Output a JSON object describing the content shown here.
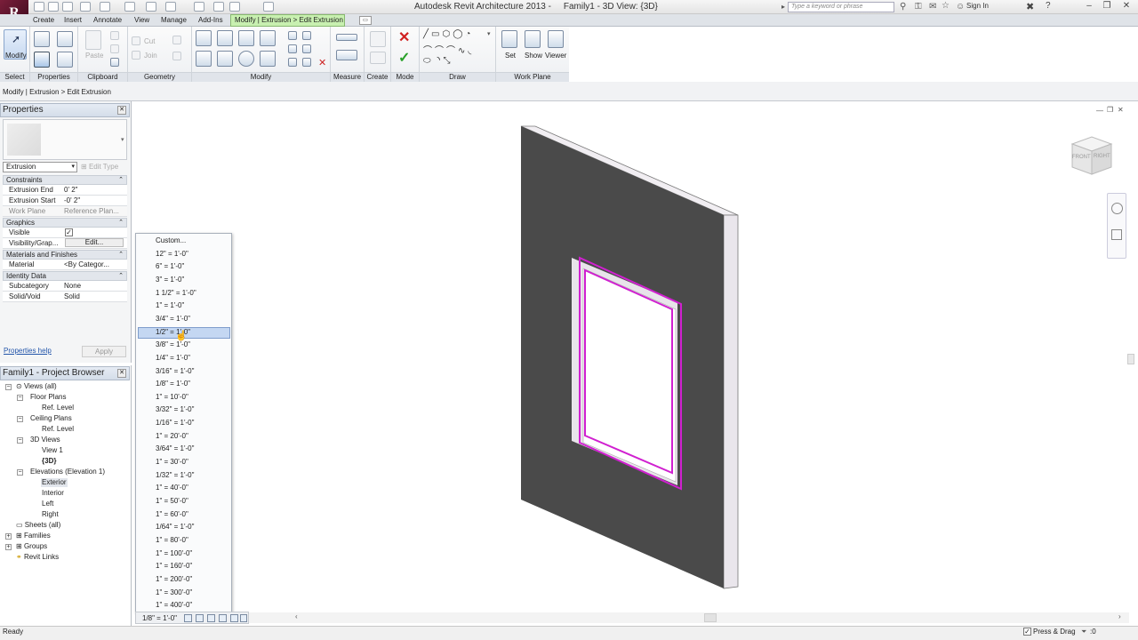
{
  "app": {
    "title": "Autodesk Revit Architecture 2013 -     Family1 - 3D View: {3D}",
    "logo": "R",
    "search_placeholder": "Type a keyword or phrase",
    "signin": "Sign In",
    "accent": "#c8f0b0"
  },
  "menu": {
    "tabs": [
      "Create",
      "Insert",
      "Annotate",
      "View",
      "Manage",
      "Add-Ins"
    ],
    "context_tab": "Modify | Extrusion > Edit Extrusion"
  },
  "ribbon": {
    "modify_label": "Modify",
    "panels": [
      "Select",
      "Properties",
      "Clipboard",
      "Geometry",
      "Modify",
      "Measure",
      "Create",
      "Mode",
      "Draw",
      "Work Plane"
    ],
    "clipboard": {
      "paste": "Paste",
      "cut": "Cut",
      "join": "Join"
    },
    "workplane": {
      "set": "Set",
      "show": "Show",
      "viewer": "Viewer"
    }
  },
  "mode_bar": "Modify | Extrusion > Edit Extrusion",
  "properties": {
    "title": "Properties",
    "type": "Extrusion",
    "edit_type": "Edit Type",
    "groups": {
      "constraints": "Constraints",
      "graphics": "Graphics",
      "materials": "Materials and Finishes",
      "identity": "Identity Data"
    },
    "rows": {
      "extrusion_end": {
        "k": "Extrusion End",
        "v": "0'  2\""
      },
      "extrusion_start": {
        "k": "Extrusion Start",
        "v": "-0'  2\""
      },
      "work_plane": {
        "k": "Work Plane",
        "v": "Reference Plan..."
      },
      "visible": {
        "k": "Visible",
        "v": "✓"
      },
      "visibility": {
        "k": "Visibility/Grap...",
        "v": "Edit..."
      },
      "material": {
        "k": "Material",
        "v": "<By Categor..."
      },
      "subcategory": {
        "k": "Subcategory",
        "v": "None"
      },
      "solid_void": {
        "k": "Solid/Void",
        "v": "Solid"
      }
    },
    "help": "Properties help",
    "apply": "Apply"
  },
  "browser": {
    "title": "Family1 - Project Browser",
    "views_all": "Views (all)",
    "floor_plans": "Floor Plans",
    "ref_level_1": "Ref. Level",
    "ceiling_plans": "Ceiling Plans",
    "ref_level_2": "Ref. Level",
    "views_3d": "3D Views",
    "view1": "View 1",
    "view_3d": "{3D}",
    "elevations": "Elevations (Elevation 1)",
    "exterior": "Exterior",
    "interior": "Interior",
    "left": "Left",
    "right": "Right",
    "sheets": "Sheets (all)",
    "families": "Families",
    "groups": "Groups",
    "revit_links": "Revit Links"
  },
  "scale_menu": {
    "items": [
      "Custom...",
      "12\" = 1'-0\"",
      "6\" = 1'-0\"",
      "3\" = 1'-0\"",
      "1 1/2\" = 1'-0\"",
      "1\" = 1'-0\"",
      "3/4\" = 1'-0\"",
      "1/2\" = 1'-0\"",
      "3/8\" = 1'-0\"",
      "1/4\" = 1'-0\"",
      "3/16\" = 1'-0\"",
      "1/8\" = 1'-0\"",
      "1\" = 10'-0\"",
      "3/32\" = 1'-0\"",
      "1/16\" = 1'-0\"",
      "1\" = 20'-0\"",
      "3/64\" = 1'-0\"",
      "1\" = 30'-0\"",
      "1/32\" = 1'-0\"",
      "1\" = 40'-0\"",
      "1\" = 50'-0\"",
      "1\" = 60'-0\"",
      "1/64\" = 1'-0\"",
      "1\" = 80'-0\"",
      "1\" = 100'-0\"",
      "1\" = 160'-0\"",
      "1\" = 200'-0\"",
      "1\" = 300'-0\"",
      "1\" = 400'-0\""
    ],
    "highlighted": "1/2\" = 1'-0\""
  },
  "viewbar": {
    "scale": "1/8\" = 1'-0\""
  },
  "viewcube": {
    "front": "FRONT",
    "right": "RIGHT"
  },
  "status": {
    "text": "Ready",
    "press_drag": "Press & Drag",
    "filter": ":0"
  },
  "colors": {
    "wall": "#4a4a4a",
    "wall_edge": "#f1eef2",
    "sketch": "#d020d0"
  }
}
